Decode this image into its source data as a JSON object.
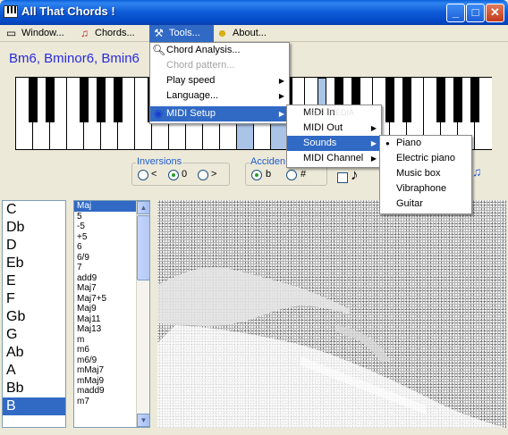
{
  "window": {
    "title": "All That Chords !",
    "minimize": "_",
    "maximize": "□",
    "close": "✕"
  },
  "menubar": {
    "window": "Window...",
    "chords": "Chords...",
    "tools": "Tools...",
    "about": "About..."
  },
  "chord_display": "Bm6, Bminor6, Bmin6",
  "tools_menu": {
    "items": [
      "Chord Analysis...",
      "Chord pattern...",
      "Play speed",
      "Language...",
      "MIDI Setup"
    ]
  },
  "midi_menu": {
    "items": [
      "MIDI In",
      "MIDI Out",
      "Sounds",
      "MIDI Channel"
    ]
  },
  "sounds_menu": {
    "items": [
      "Piano",
      "Electric piano",
      "Music box",
      "Vibraphone",
      "Guitar"
    ],
    "selected": "Piano"
  },
  "inversions": {
    "label": "Inversions",
    "opt1": "<",
    "opt2": "0",
    "opt3": ">",
    "selected": "0"
  },
  "accidentals": {
    "label": "Acciden",
    "opt1": "b",
    "opt2": "#",
    "selected": "b"
  },
  "notes": [
    "C",
    "Db",
    "D",
    "Eb",
    "E",
    "F",
    "Gb",
    "G",
    "Ab",
    "A",
    "Bb",
    "B"
  ],
  "selected_note": "B",
  "chord_types": [
    "Maj",
    "5",
    "-5",
    "+5",
    "6",
    "6/9",
    "7",
    "add9",
    "Maj7",
    "Maj7+5",
    "Maj9",
    "Maj11",
    "Maj13",
    "m",
    "m6",
    "m6/9",
    "mMaj7",
    "mMaj9",
    "madd9",
    "m7"
  ],
  "selected_type": "Maj",
  "watermark": "SOFTPEDIA\nwww.softpedia.com",
  "colors": {
    "accent": "#316ac5",
    "titlebar": "#0d5ad6",
    "chord_text": "#2a2add",
    "key_highlight": "#a9c4e6"
  }
}
